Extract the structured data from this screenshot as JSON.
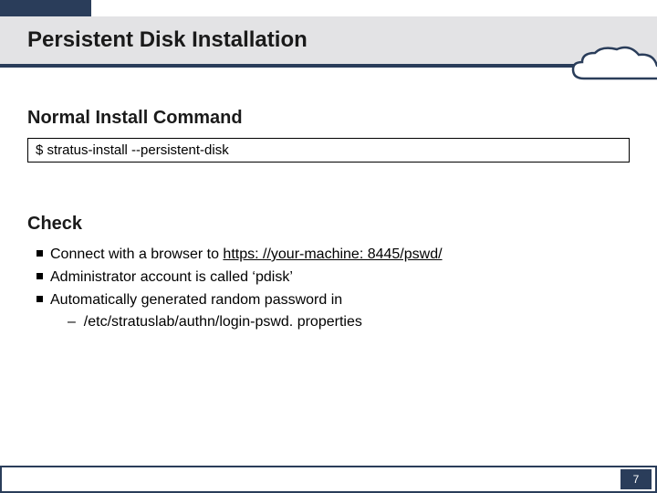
{
  "title": "Persistent Disk Installation",
  "section1": {
    "heading": "Normal Install Command",
    "command": "$ stratus-install --persistent-disk"
  },
  "section2": {
    "heading": "Check",
    "b1_pre": "Connect with a browser to ",
    "b1_link": "https: //your-machine: 8445/pswd/",
    "b2": "Administrator account is called ‘pdisk’",
    "b3": "Automatically generated random password in",
    "b3_sub": "–  /etc/stratuslab/authn/login-pswd. properties"
  },
  "page_number": "7"
}
